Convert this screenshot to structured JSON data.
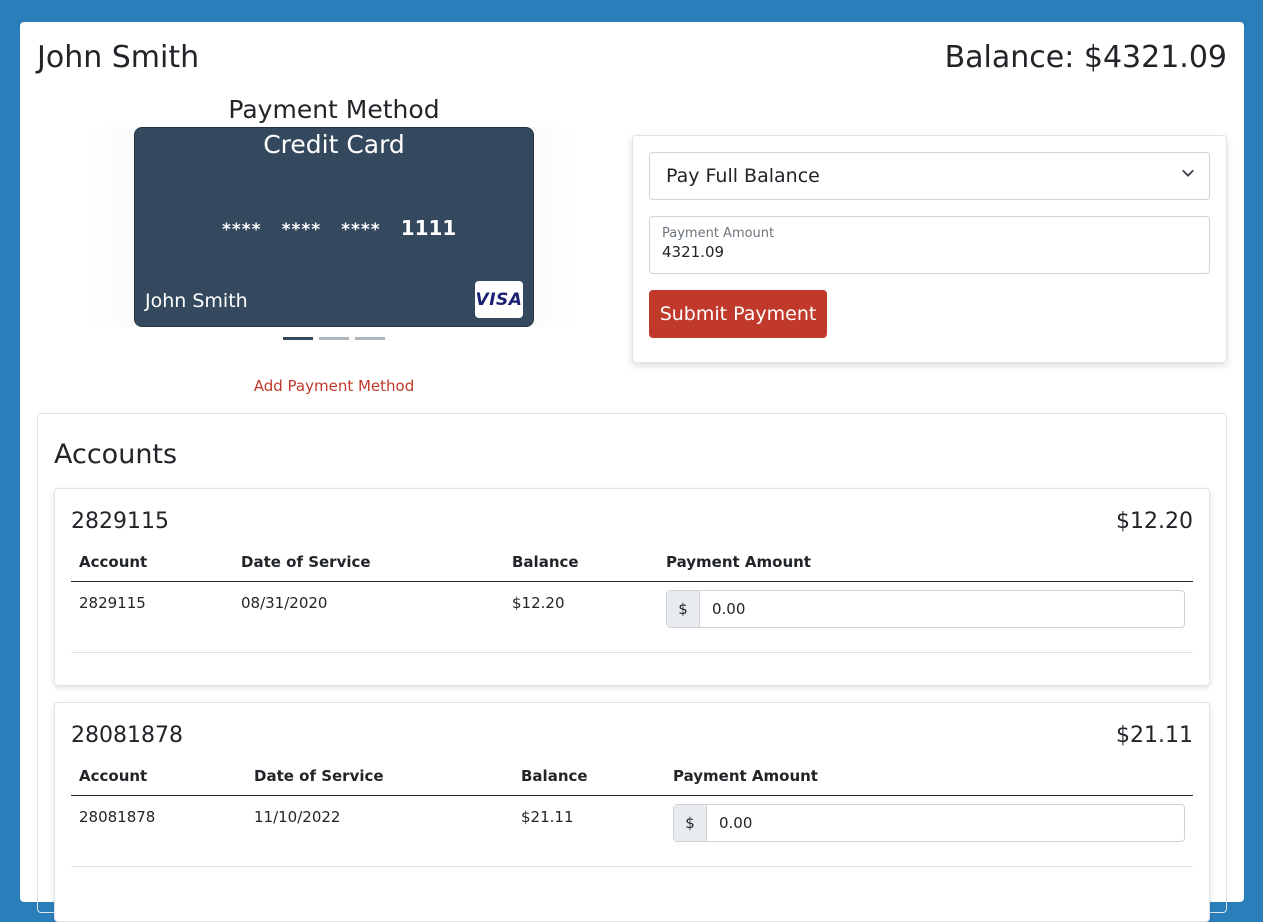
{
  "header": {
    "customer_name": "John Smith",
    "balance_label": "Balance: $4321.09"
  },
  "payment_method": {
    "title": "Payment Method",
    "card": {
      "type": "Credit Card",
      "masked_groups": [
        "****",
        "****",
        "****"
      ],
      "last4": "1111",
      "holder": "John Smith",
      "brand": "VISA"
    },
    "carousel": {
      "count": 3,
      "active_index": 0
    },
    "add_link": "Add Payment Method"
  },
  "payment_form": {
    "select_value": "Pay Full Balance",
    "amount_label": "Payment Amount",
    "amount_value": "4321.09",
    "submit_label": "Submit Payment"
  },
  "accounts": {
    "title": "Accounts",
    "columns": [
      "Account",
      "Date of Service",
      "Balance",
      "Payment Amount"
    ],
    "items": [
      {
        "number": "2829115",
        "balance": "$12.20",
        "row": {
          "account": "2829115",
          "date": "08/31/2020",
          "balance": "$12.20",
          "currency": "$",
          "payment": "0.00"
        }
      },
      {
        "number": "28081878",
        "balance": "$21.11",
        "row": {
          "account": "28081878",
          "date": "11/10/2022",
          "balance": "$21.11",
          "currency": "$",
          "payment": "0.00"
        }
      }
    ]
  },
  "colors": {
    "page_background": "#2a7fba",
    "card_background": "#34495e",
    "accent": "#c0392b"
  }
}
